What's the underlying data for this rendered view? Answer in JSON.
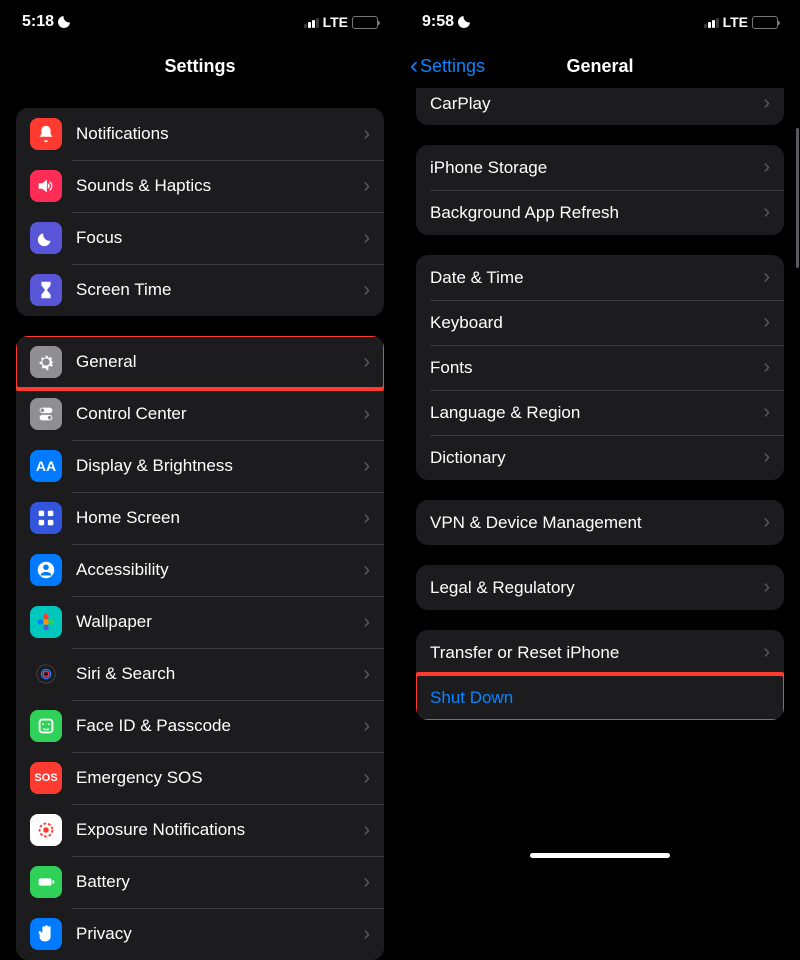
{
  "left": {
    "status": {
      "time": "5:18",
      "network": "LTE"
    },
    "nav": {
      "title": "Settings"
    },
    "group1": [
      {
        "id": "notifications",
        "label": "Notifications",
        "icon_bg": "#ff3a30",
        "icon": "bell"
      },
      {
        "id": "sounds",
        "label": "Sounds & Haptics",
        "icon_bg": "#ff2d55",
        "icon": "speaker"
      },
      {
        "id": "focus",
        "label": "Focus",
        "icon_bg": "#5856d6",
        "icon": "moon"
      },
      {
        "id": "screentime",
        "label": "Screen Time",
        "icon_bg": "#5856d6",
        "icon": "hourglass"
      }
    ],
    "group2": [
      {
        "id": "general",
        "label": "General",
        "icon_bg": "#8e8e93",
        "icon": "gear",
        "highlight": true
      },
      {
        "id": "controlcenter",
        "label": "Control Center",
        "icon_bg": "#8e8e93",
        "icon": "toggles"
      },
      {
        "id": "display",
        "label": "Display & Brightness",
        "icon_bg": "#007aff",
        "icon": "AA"
      },
      {
        "id": "homescreen",
        "label": "Home Screen",
        "icon_bg": "#3355dd",
        "icon": "grid"
      },
      {
        "id": "accessibility",
        "label": "Accessibility",
        "icon_bg": "#007aff",
        "icon": "person"
      },
      {
        "id": "wallpaper",
        "label": "Wallpaper",
        "icon_bg": "#00c7be",
        "icon": "flower"
      },
      {
        "id": "siri",
        "label": "Siri & Search",
        "icon_bg": "#1c1c1e",
        "icon": "siri"
      },
      {
        "id": "faceid",
        "label": "Face ID & Passcode",
        "icon_bg": "#30d158",
        "icon": "face"
      },
      {
        "id": "sos",
        "label": "Emergency SOS",
        "icon_bg": "#ff3a30",
        "icon": "SOS"
      },
      {
        "id": "exposure",
        "label": "Exposure Notifications",
        "icon_bg": "#ffffff",
        "icon": "exposure"
      },
      {
        "id": "battery",
        "label": "Battery",
        "icon_bg": "#30d158",
        "icon": "battery"
      },
      {
        "id": "privacy",
        "label": "Privacy",
        "icon_bg": "#007aff",
        "icon": "hand"
      }
    ]
  },
  "right": {
    "status": {
      "time": "9:58",
      "network": "LTE"
    },
    "nav": {
      "back": "Settings",
      "title": "General"
    },
    "group0": [
      {
        "id": "carplay",
        "label": "CarPlay"
      }
    ],
    "group1": [
      {
        "id": "storage",
        "label": "iPhone Storage"
      },
      {
        "id": "bgrefresh",
        "label": "Background App Refresh"
      }
    ],
    "group2": [
      {
        "id": "datetime",
        "label": "Date & Time"
      },
      {
        "id": "keyboard",
        "label": "Keyboard"
      },
      {
        "id": "fonts",
        "label": "Fonts"
      },
      {
        "id": "language",
        "label": "Language & Region"
      },
      {
        "id": "dictionary",
        "label": "Dictionary"
      }
    ],
    "group3": [
      {
        "id": "vpn",
        "label": "VPN & Device Management"
      }
    ],
    "group4": [
      {
        "id": "legal",
        "label": "Legal & Regulatory"
      }
    ],
    "group5": [
      {
        "id": "transfer",
        "label": "Transfer or Reset iPhone"
      },
      {
        "id": "shutdown",
        "label": "Shut Down",
        "blue": true,
        "no_chevron": true,
        "highlight": true
      }
    ]
  }
}
